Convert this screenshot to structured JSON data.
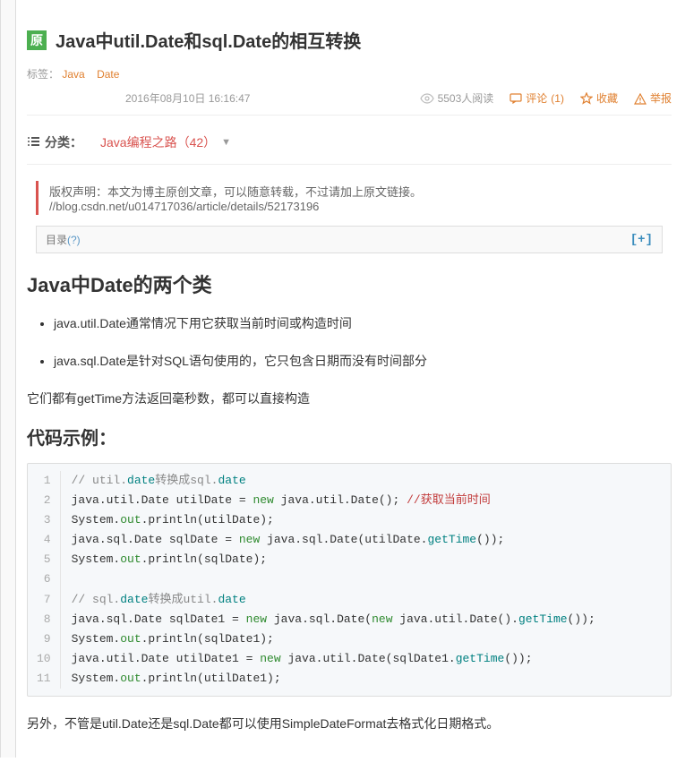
{
  "badge": "原",
  "title": "Java中util.Date和sql.Date的相互转换",
  "tags_label": "标签：",
  "tags": [
    "Java",
    "Date"
  ],
  "meta": {
    "date": "2016年08月10日 16:16:47",
    "views": "5503人阅读",
    "comments_label": "评论",
    "comments_count": "(1)",
    "favorite": "收藏",
    "report": "举报"
  },
  "category": {
    "icon_label": "分类：",
    "link": "Java编程之路（42）"
  },
  "copyright": {
    "prefix": "版权声明：本文为博主原创文章，可以随意转载，不过请加上原文链接。",
    "url": "//blog.csdn.net/u014717036/article/details/52173196"
  },
  "toc": {
    "label": "目录",
    "q": "(?)",
    "plus": "[+]"
  },
  "heading1": "Java中Date的两个类",
  "bullets": [
    "java.util.Date通常情况下用它获取当前时间或构造时间",
    "java.sql.Date是针对SQL语句使用的，它只包含日期而没有时间部分"
  ],
  "para1": "它们都有getTime方法返回毫秒数，都可以直接构造",
  "heading2": "代码示例：",
  "code": [
    {
      "ln": 1,
      "segs": [
        {
          "t": "// util.",
          "c": "c-comment"
        },
        {
          "t": "date",
          "c": "c-method"
        },
        {
          "t": "转换成sql.",
          "c": "c-comment"
        },
        {
          "t": "date",
          "c": "c-method"
        }
      ]
    },
    {
      "ln": 2,
      "segs": [
        {
          "t": "java.util.Date utilDate = ",
          "c": "c-type"
        },
        {
          "t": "new",
          "c": "c-kw"
        },
        {
          "t": " java.util.Date(); ",
          "c": "c-type"
        },
        {
          "t": "//获取当前时间",
          "c": "c-comment-red"
        }
      ]
    },
    {
      "ln": 3,
      "segs": [
        {
          "t": "System.",
          "c": "c-sys"
        },
        {
          "t": "out",
          "c": "c-kw"
        },
        {
          "t": ".println(utilDate);",
          "c": "c-sys"
        }
      ]
    },
    {
      "ln": 4,
      "segs": [
        {
          "t": "java.sql.Date sqlDate = ",
          "c": "c-type"
        },
        {
          "t": "new",
          "c": "c-kw"
        },
        {
          "t": " java.sql.Date(utilDate.",
          "c": "c-type"
        },
        {
          "t": "getTime",
          "c": "c-method"
        },
        {
          "t": "());",
          "c": "c-type"
        }
      ]
    },
    {
      "ln": 5,
      "segs": [
        {
          "t": "System.",
          "c": "c-sys"
        },
        {
          "t": "out",
          "c": "c-kw"
        },
        {
          "t": ".println(sqlDate);",
          "c": "c-sys"
        }
      ]
    },
    {
      "ln": 6,
      "segs": [
        {
          "t": " ",
          "c": "c-type"
        }
      ]
    },
    {
      "ln": 7,
      "segs": [
        {
          "t": "// sql.",
          "c": "c-comment"
        },
        {
          "t": "date",
          "c": "c-method"
        },
        {
          "t": "转换成util.",
          "c": "c-comment"
        },
        {
          "t": "date",
          "c": "c-method"
        }
      ]
    },
    {
      "ln": 8,
      "segs": [
        {
          "t": "java.sql.Date sqlDate1 = ",
          "c": "c-type"
        },
        {
          "t": "new",
          "c": "c-kw"
        },
        {
          "t": " java.sql.Date(",
          "c": "c-type"
        },
        {
          "t": "new",
          "c": "c-kw"
        },
        {
          "t": " java.util.Date().",
          "c": "c-type"
        },
        {
          "t": "getTime",
          "c": "c-method"
        },
        {
          "t": "());",
          "c": "c-type"
        }
      ]
    },
    {
      "ln": 9,
      "segs": [
        {
          "t": "System.",
          "c": "c-sys"
        },
        {
          "t": "out",
          "c": "c-kw"
        },
        {
          "t": ".println(sqlDate1);",
          "c": "c-sys"
        }
      ]
    },
    {
      "ln": 10,
      "segs": [
        {
          "t": "java.util.Date utilDate1 = ",
          "c": "c-type"
        },
        {
          "t": "new",
          "c": "c-kw"
        },
        {
          "t": " java.util.Date(sqlDate1.",
          "c": "c-type"
        },
        {
          "t": "getTime",
          "c": "c-method"
        },
        {
          "t": "());",
          "c": "c-type"
        }
      ]
    },
    {
      "ln": 11,
      "segs": [
        {
          "t": "System.",
          "c": "c-sys"
        },
        {
          "t": "out",
          "c": "c-kw"
        },
        {
          "t": ".println(utilDate1);",
          "c": "c-sys"
        }
      ]
    }
  ],
  "para2": "另外，不管是util.Date还是sql.Date都可以使用SimpleDateFormat去格式化日期格式。"
}
